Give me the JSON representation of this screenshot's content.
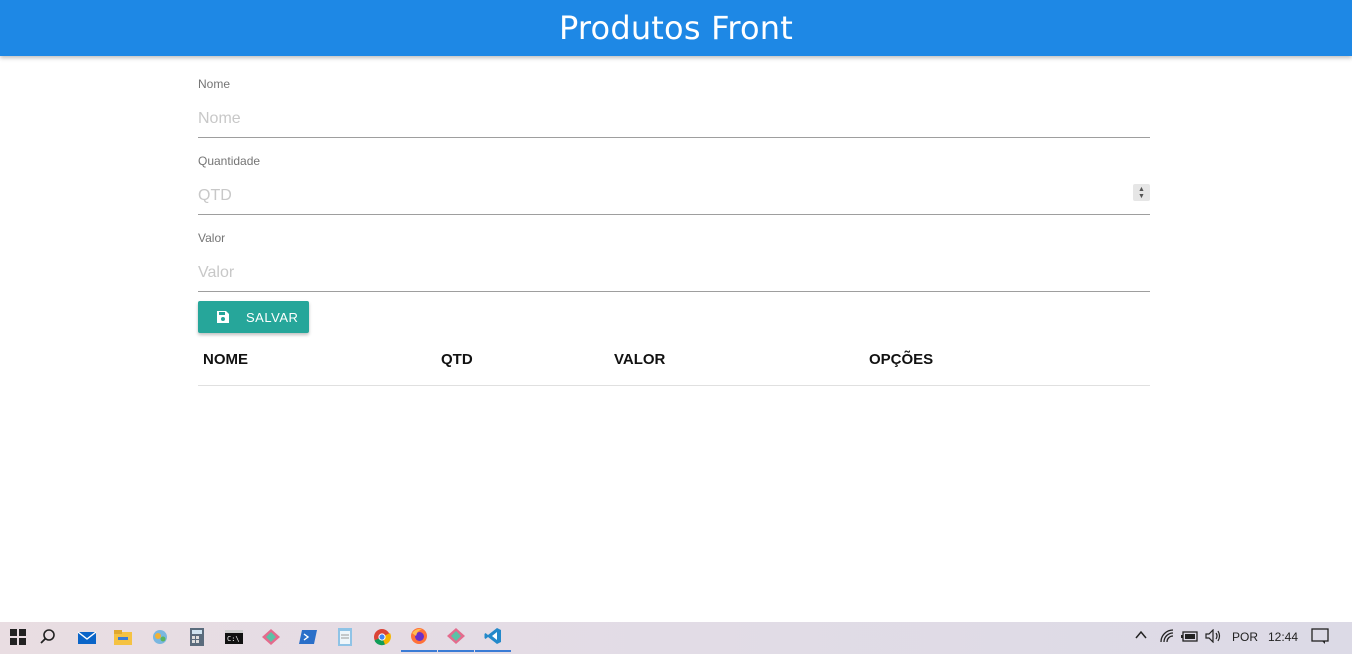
{
  "header": {
    "title": "Produtos Front",
    "color": "#1e88e5"
  },
  "form": {
    "nome": {
      "label": "Nome",
      "placeholder": "Nome",
      "value": ""
    },
    "quantidade": {
      "label": "Quantidade",
      "placeholder": "QTD",
      "value": ""
    },
    "valor": {
      "label": "Valor",
      "placeholder": "Valor",
      "value": ""
    },
    "save_button": {
      "label": "SALVAR",
      "icon": "save-icon",
      "color": "#26a69a"
    }
  },
  "table": {
    "headers": [
      "NOME",
      "QTD",
      "VALOR",
      "OPÇÕES"
    ],
    "rows": []
  },
  "taskbar": {
    "apps": [
      "windows-start-icon",
      "search-icon",
      "mail-icon",
      "file-explorer-icon",
      "control-panel-icon",
      "calculator-icon",
      "cmd-icon",
      "app-icon",
      "powershell-icon",
      "notepad-icon",
      "chrome-icon",
      "firefox-icon",
      "app-icon-2",
      "vscode-icon"
    ],
    "active_apps": [
      "firefox-icon",
      "app-icon-2",
      "vscode-icon"
    ],
    "tray": {
      "language": "POR",
      "time": "12:44"
    }
  }
}
